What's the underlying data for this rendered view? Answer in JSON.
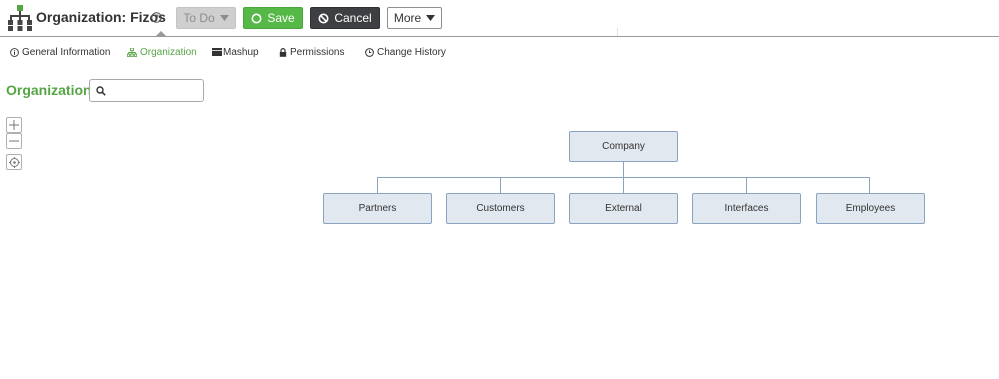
{
  "header": {
    "title": "Organization: Fizos",
    "todo_label": "To Do",
    "save_label": "Save",
    "cancel_label": "Cancel",
    "more_label": "More"
  },
  "tabs": [
    {
      "label": "General Information",
      "icon": "info-circle-icon",
      "active": false
    },
    {
      "label": "Organization",
      "icon": "org-chart-icon",
      "active": true
    },
    {
      "label": "Mashup",
      "icon": "mashup-icon",
      "active": false
    },
    {
      "label": "Permissions",
      "icon": "lock-icon",
      "active": false
    },
    {
      "label": "Change History",
      "icon": "clock-icon",
      "active": false
    }
  ],
  "panel": {
    "title": "Organization",
    "search_value": ""
  },
  "org_chart": {
    "root": "Company",
    "children": [
      "Partners",
      "Customers",
      "External",
      "Interfaces",
      "Employees"
    ]
  },
  "colors": {
    "accent_green": "#56a545",
    "save_green": "#56b847",
    "cancel_dark": "#3d3f42",
    "node_fill": "#e2e8f0",
    "node_border": "#8aa3bf"
  }
}
